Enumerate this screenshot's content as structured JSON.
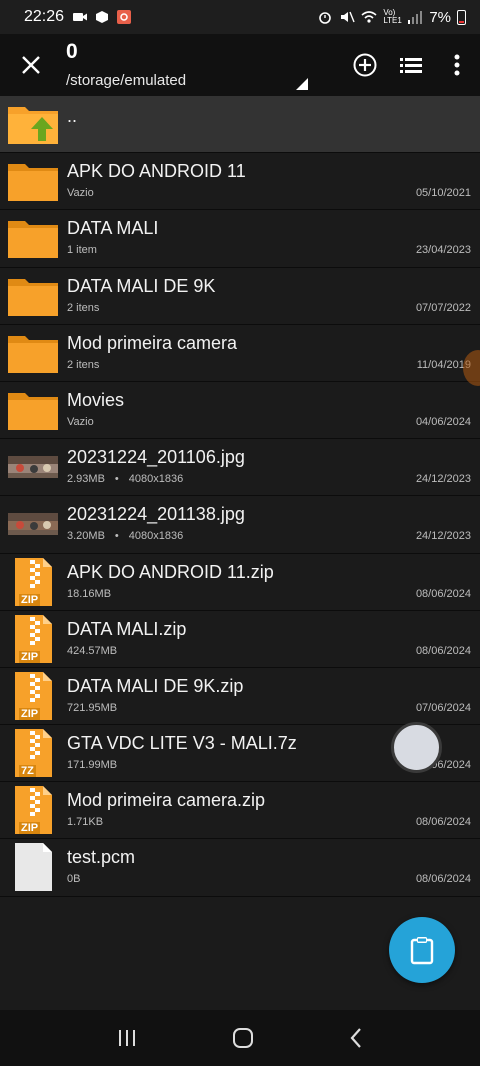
{
  "status_bar": {
    "time": "22:26",
    "battery": "7%",
    "network": "Vo) LTE1"
  },
  "toolbar": {
    "count": "0",
    "path": "/storage/emulated"
  },
  "parent_row": {
    "name": ".."
  },
  "files": [
    {
      "name": "APK DO ANDROID 11",
      "meta": "Vazio",
      "date": "05/10/2021",
      "type": "folder"
    },
    {
      "name": "DATA MALI",
      "meta": "1 item",
      "date": "23/04/2023",
      "type": "folder"
    },
    {
      "name": "DATA MALI DE 9K",
      "meta": "2 itens",
      "date": "07/07/2022",
      "type": "folder"
    },
    {
      "name": "Mod primeira camera",
      "meta": "2 itens",
      "date": "11/04/2019",
      "type": "folder"
    },
    {
      "name": "Movies",
      "meta": "Vazio",
      "date": "04/06/2024",
      "type": "folder"
    },
    {
      "name": "20231224_201106.jpg",
      "size": "2.93MB",
      "dims": "4080x1836",
      "date": "24/12/2023",
      "type": "image"
    },
    {
      "name": "20231224_201138.jpg",
      "size": "3.20MB",
      "dims": "4080x1836",
      "date": "24/12/2023",
      "type": "image"
    },
    {
      "name": "APK DO ANDROID 11.zip",
      "meta": "18.16MB",
      "date": "08/06/2024",
      "type": "archive",
      "badge": "ZIP"
    },
    {
      "name": "DATA MALI.zip",
      "meta": "424.57MB",
      "date": "08/06/2024",
      "type": "archive",
      "badge": "ZIP"
    },
    {
      "name": "DATA MALI DE 9K.zip",
      "meta": "721.95MB",
      "date": "07/06/2024",
      "type": "archive",
      "badge": "ZIP"
    },
    {
      "name": "GTA VDC LITE V3 - MALI.7z",
      "meta": "171.99MB",
      "date": "06/2024",
      "type": "archive",
      "badge": "7Z"
    },
    {
      "name": "Mod primeira camera.zip",
      "meta": "1.71KB",
      "date": "08/06/2024",
      "type": "archive",
      "badge": "ZIP"
    },
    {
      "name": "test.pcm",
      "meta": "0B",
      "date": "08/06/2024",
      "type": "file"
    }
  ],
  "colors": {
    "folder": "#f7a12a",
    "folder_dark": "#e08a14",
    "fab": "#25a3d8",
    "up_arrow": "#6aa61f"
  }
}
